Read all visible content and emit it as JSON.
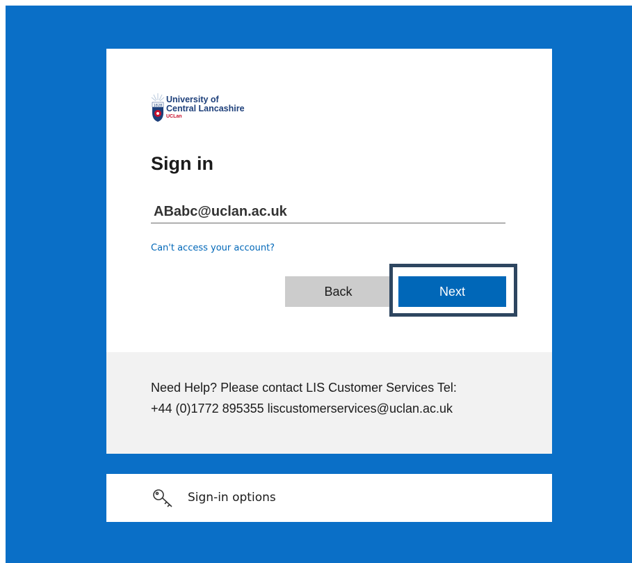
{
  "logo": {
    "line1": "University of",
    "line2": "Central Lancashire",
    "sub": "UCLan",
    "year": "1828"
  },
  "signin": {
    "title": "Sign in",
    "email_value": "ABabc@uclan.ac.uk",
    "cant_access_link": "Can't access your account?",
    "back_label": "Back",
    "next_label": "Next"
  },
  "help": {
    "line1": "Need Help? Please contact LIS Customer Services Tel:",
    "line2": "+44 (0)1772 895355 liscustomerservices@uclan.ac.uk"
  },
  "options": {
    "label": "Sign-in options",
    "icon": "key-icon"
  },
  "colors": {
    "background": "#0a6fc7",
    "primary_button": "#0067b8",
    "secondary_button": "#cccccc",
    "focus_ring": "#2e4660",
    "link": "#0067b8"
  }
}
